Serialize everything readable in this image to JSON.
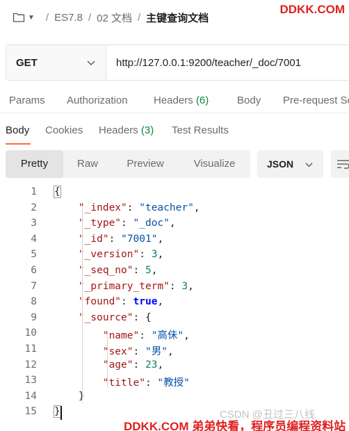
{
  "breadcrumb": {
    "items": [
      "ES7.8",
      "02 文档"
    ],
    "current": "主键查询文档"
  },
  "watermarks": {
    "top": "DDKK.COM",
    "bottom": "DDKK.COM 弟弟快看，程序员编程资料站",
    "csdn": "CSDN @丑过三八线"
  },
  "request": {
    "method": "GET",
    "url": "http://127.0.0.1:9200/teacher/_doc/7001"
  },
  "request_tabs": [
    {
      "label": "Params",
      "count": ""
    },
    {
      "label": "Authorization",
      "count": ""
    },
    {
      "label": "Headers",
      "count": "(6)"
    },
    {
      "label": "Body",
      "count": ""
    },
    {
      "label": "Pre-request Scr",
      "count": ""
    }
  ],
  "response_tabs": [
    {
      "label": "Body",
      "count": ""
    },
    {
      "label": "Cookies",
      "count": ""
    },
    {
      "label": "Headers",
      "count": "(3)"
    },
    {
      "label": "Test Results",
      "count": ""
    }
  ],
  "view_modes": [
    "Pretty",
    "Raw",
    "Preview",
    "Visualize"
  ],
  "active_view_mode": "Pretty",
  "format": "JSON",
  "line_numbers": [
    "1",
    "2",
    "3",
    "4",
    "5",
    "6",
    "7",
    "8",
    "9",
    "10",
    "11",
    "12",
    "13",
    "14",
    "15"
  ],
  "colors": {
    "accent": "#ff6c37",
    "count_green": "#0c8a3b",
    "json_key": "#a31515",
    "json_string": "#0451a5",
    "json_number": "#098658",
    "json_bool": "#0000ff"
  },
  "icons": {
    "breadcrumb": "folder-icon",
    "dropdown": "chevron-down-icon",
    "wrap": "wrap-lines-icon"
  },
  "response_json": [
    [
      [
        "p",
        "{"
      ]
    ],
    [
      [
        "p",
        "    "
      ],
      [
        "k",
        "\"_index\""
      ],
      [
        "p",
        ": "
      ],
      [
        "s",
        "\"teacher\""
      ],
      [
        "p",
        ","
      ]
    ],
    [
      [
        "p",
        "    "
      ],
      [
        "k",
        "\"_type\""
      ],
      [
        "p",
        ": "
      ],
      [
        "s",
        "\"_doc\""
      ],
      [
        "p",
        ","
      ]
    ],
    [
      [
        "p",
        "    "
      ],
      [
        "k",
        "\"_id\""
      ],
      [
        "p",
        ": "
      ],
      [
        "s",
        "\"7001\""
      ],
      [
        "p",
        ","
      ]
    ],
    [
      [
        "p",
        "    "
      ],
      [
        "k",
        "\"_version\""
      ],
      [
        "p",
        ": "
      ],
      [
        "n",
        "3"
      ],
      [
        "p",
        ","
      ]
    ],
    [
      [
        "p",
        "    "
      ],
      [
        "k",
        "\"_seq_no\""
      ],
      [
        "p",
        ": "
      ],
      [
        "n",
        "5"
      ],
      [
        "p",
        ","
      ]
    ],
    [
      [
        "p",
        "    "
      ],
      [
        "k",
        "\"_primary_term\""
      ],
      [
        "p",
        ": "
      ],
      [
        "n",
        "3"
      ],
      [
        "p",
        ","
      ]
    ],
    [
      [
        "p",
        "    "
      ],
      [
        "k",
        "\"found\""
      ],
      [
        "p",
        ": "
      ],
      [
        "b",
        "true"
      ],
      [
        "p",
        ","
      ]
    ],
    [
      [
        "p",
        "    "
      ],
      [
        "k",
        "\"_source\""
      ],
      [
        "p",
        ": {"
      ]
    ],
    [
      [
        "p",
        "        "
      ],
      [
        "k",
        "\"name\""
      ],
      [
        "p",
        ": "
      ],
      [
        "s",
        "\"高佅\""
      ],
      [
        "p",
        ","
      ]
    ],
    [
      [
        "p",
        "        "
      ],
      [
        "k",
        "\"sex\""
      ],
      [
        "p",
        ": "
      ],
      [
        "s",
        "\"男\""
      ],
      [
        "p",
        ","
      ]
    ],
    [
      [
        "p",
        "        "
      ],
      [
        "k",
        "\"age\""
      ],
      [
        "p",
        ": "
      ],
      [
        "n",
        "23"
      ],
      [
        "p",
        ","
      ]
    ],
    [
      [
        "p",
        "        "
      ],
      [
        "k",
        "\"title\""
      ],
      [
        "p",
        ": "
      ],
      [
        "s",
        "\"教授\""
      ]
    ],
    [
      [
        "p",
        "    }"
      ]
    ],
    [
      [
        "p",
        "}"
      ]
    ]
  ]
}
